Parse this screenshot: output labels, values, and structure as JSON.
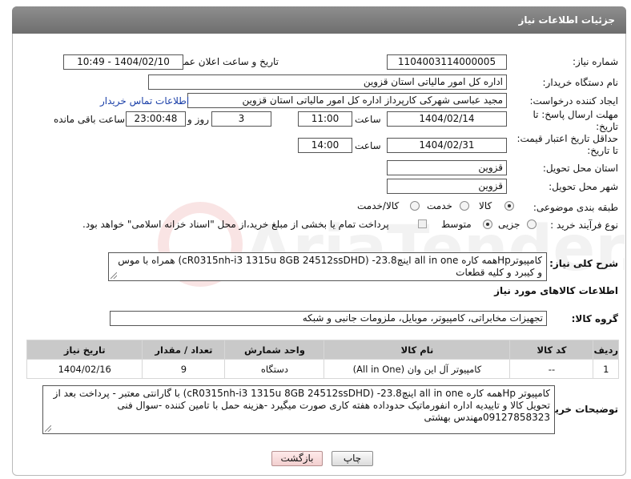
{
  "header": {
    "title": "جزئیات اطلاعات نیاز"
  },
  "form": {
    "need_number": {
      "label": "شماره نیاز:",
      "value": "1104003114000005"
    },
    "announce_datetime": {
      "label": "تاریخ و ساعت اعلان عمومی:",
      "value": "1404/02/10 - 10:49"
    },
    "buyer_org": {
      "label": "نام دستگاه خریدار:",
      "value": "اداره کل امور مالیاتی استان قزوین"
    },
    "requester": {
      "label": "ایجاد کننده درخواست:",
      "value": "مجید عباسی شهرکی کارپرداز اداره کل امور مالیاتی استان قزوین",
      "contact_link": "اطلاعات تماس خریدار"
    },
    "reply_deadline": {
      "label_line1": "مهلت ارسال پاسخ: تا",
      "label_line2": "تاریخ:",
      "date": "1404/02/14",
      "time_label": "ساعت",
      "time": "11:00",
      "days": "3",
      "days_label": "روز و",
      "remaining": "23:00:48",
      "remaining_label": "ساعت باقی مانده"
    },
    "price_validity": {
      "label_line1": "حداقل تاریخ اعتبار قیمت:",
      "label_line2": "تا تاریخ:",
      "date": "1404/02/31",
      "time_label": "ساعت",
      "time": "14:00"
    },
    "delivery_province": {
      "label": "استان محل تحویل:",
      "value": "قزوین"
    },
    "delivery_city": {
      "label": "شهر محل تحویل:",
      "value": "قزوین"
    },
    "category": {
      "label": "طبقه بندی موضوعی:",
      "options": [
        "کالا",
        "خدمت",
        "کالا/خدمت"
      ],
      "selected": "کالا"
    },
    "purchase_process": {
      "label": "نوع فرآیند خرید :",
      "options": [
        "جزیی",
        "متوسط"
      ],
      "selected": "متوسط",
      "payment_note": "پرداخت تمام یا بخشی از مبلغ خرید،از محل \"اسناد خزانه اسلامی\" خواهد بود."
    },
    "description": {
      "label": "شرح کلی نیاز:",
      "value": "کامپیوترHpهمه کاره all in one اینچ23.8- (cR0315nh-i3 1315u 8GB 24512ssDHD) همراه با موس و کیبرد و کلیه قطعات"
    }
  },
  "goods_section": {
    "title": "اطلاعات کالاهای مورد نیاز",
    "group_label": "گروه کالا:",
    "group_value": "تجهیزات مخابراتی، کامپیوتر، موبایل، ملزومات جانبی و شبکه",
    "table": {
      "columns": [
        "ردیف",
        "کد کالا",
        "نام کالا",
        "واحد شمارش",
        "تعداد / مقدار",
        "تاریخ نیاز"
      ],
      "rows": [
        {
          "row": "1",
          "code": "--",
          "name": "کامپیوتر آل این وان (All in One)",
          "unit": "دستگاه",
          "qty": "9",
          "date": "1404/02/16"
        }
      ]
    }
  },
  "buyer_notes": {
    "label": "توضیحات خریدار:",
    "line1": "کامپیوتر Hpهمه کاره all in one اینچ23.8- (cR0315nh-i3 1315u 8GB 24512ssDHD) با گارانتی معتبر - پرداخت بعد از",
    "line2": "تحویل کالا و تاییدیه اداره انفورماتیک حدوداده هفته کاری صورت میگیرد -هزینه حمل با تامین کننده -سوال فنی",
    "line3": "09127858323مهندس بهشتی"
  },
  "buttons": {
    "print": "چاپ",
    "back": "بازگشت"
  },
  "watermark": {
    "text": "AriaTender.neT"
  }
}
